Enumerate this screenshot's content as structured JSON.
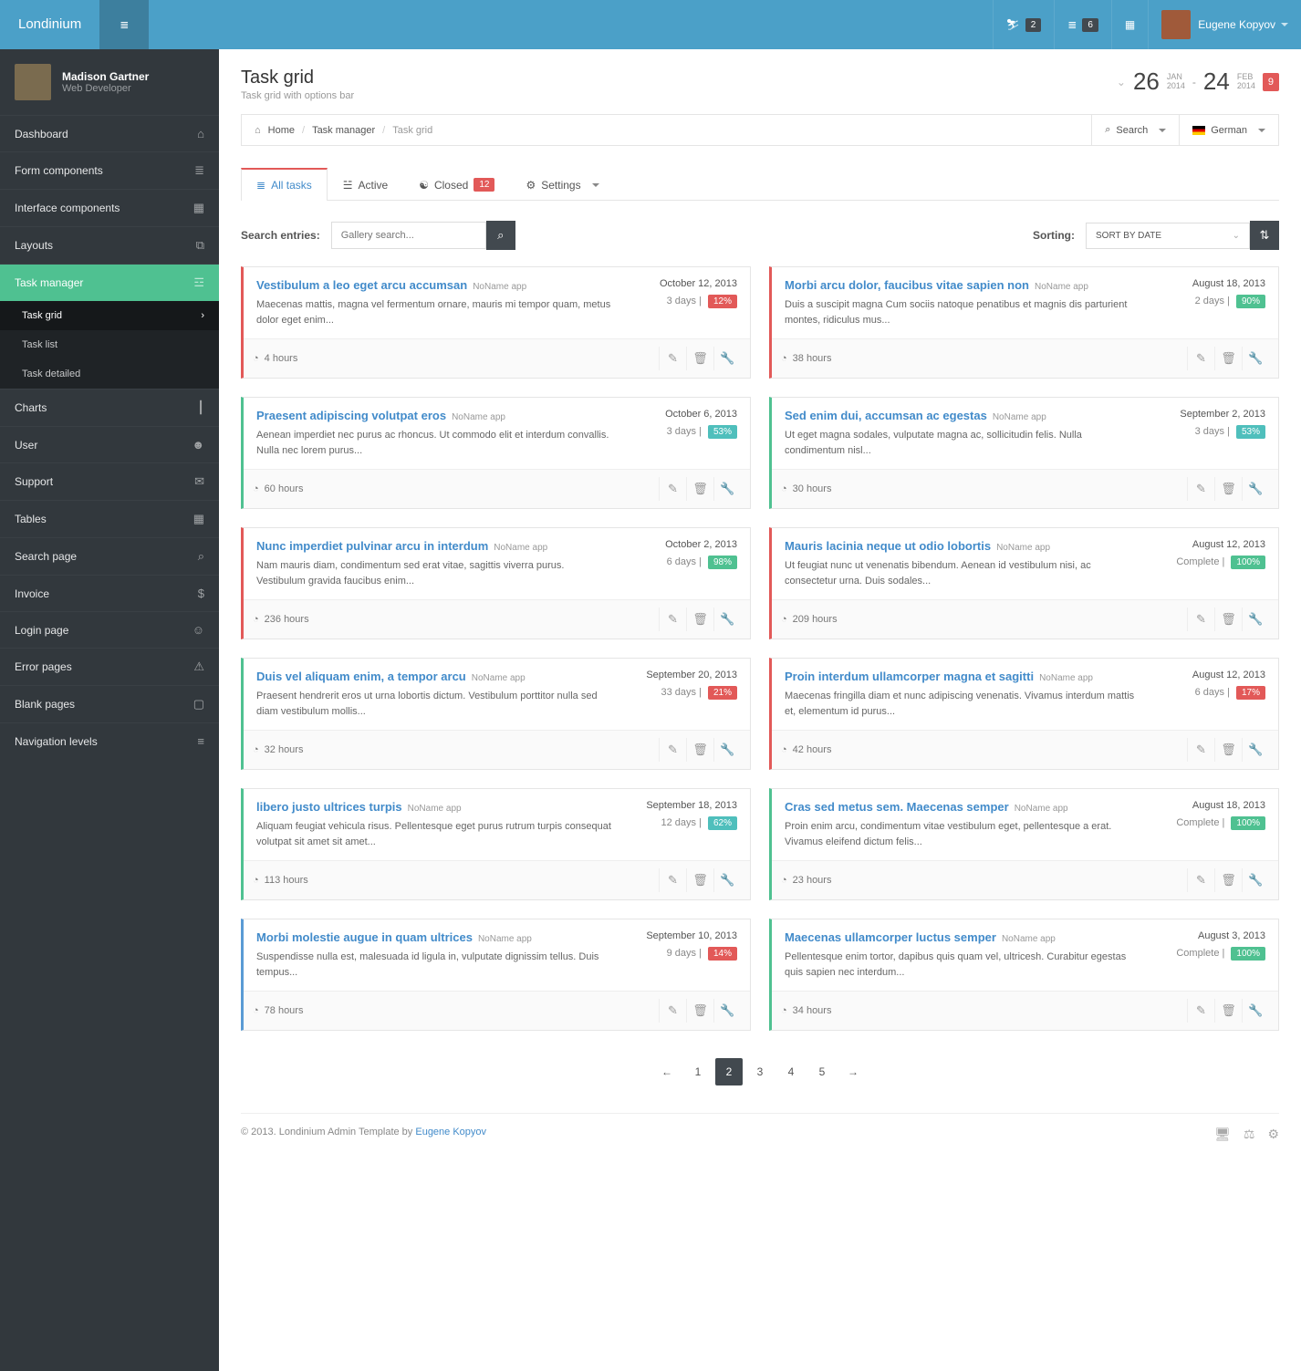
{
  "brand": "Londinium",
  "topnav": {
    "people_count": "2",
    "list_count": "6",
    "user_name": "Eugene Kopyov"
  },
  "sidebar": {
    "profile_name": "Madison Gartner",
    "profile_role": "Web Developer",
    "items": [
      {
        "label": "Dashboard",
        "icon": "⌂"
      },
      {
        "label": "Form components",
        "icon": "≣"
      },
      {
        "label": "Interface components",
        "icon": "▦"
      },
      {
        "label": "Layouts",
        "icon": "⧉"
      },
      {
        "label": "Task manager",
        "icon": "☲",
        "active": true
      },
      {
        "label": "Charts",
        "icon": "┃"
      },
      {
        "label": "User",
        "icon": "☻"
      },
      {
        "label": "Support",
        "icon": "✉"
      },
      {
        "label": "Tables",
        "icon": "▦"
      },
      {
        "label": "Search page",
        "icon": "⌕"
      },
      {
        "label": "Invoice",
        "icon": "$"
      },
      {
        "label": "Login page",
        "icon": "☺"
      },
      {
        "label": "Error pages",
        "icon": "⚠"
      },
      {
        "label": "Blank pages",
        "icon": "▢"
      },
      {
        "label": "Navigation levels",
        "icon": "≡"
      }
    ],
    "submenu": [
      {
        "label": "Task grid",
        "active": true
      },
      {
        "label": "Task list"
      },
      {
        "label": "Task detailed"
      }
    ]
  },
  "page": {
    "title": "Task grid",
    "subtitle": "Task grid with options bar",
    "date": {
      "d1": "26",
      "m1": "Jan",
      "y1": "2014",
      "d2": "24",
      "m2": "Feb",
      "y2": "2014",
      "tag": "9"
    }
  },
  "breadcrumb": {
    "home": "Home",
    "mid": "Task manager",
    "last": "Task grid",
    "search": "Search",
    "lang": "German"
  },
  "tabs": {
    "all": "All tasks",
    "active": "Active",
    "closed": "Closed",
    "closed_count": "12",
    "settings": "Settings"
  },
  "toolbar": {
    "search_label": "Search entries:",
    "search_placeholder": "Gallery search...",
    "sort_label": "Sorting:",
    "sort_value": "SORT BY DATE"
  },
  "tasks_left": [
    {
      "title": "Vestibulum a leo eget arcu accumsan",
      "app": "NoName app",
      "desc": "Maecenas mattis, magna vel fermentum ornare, mauris mi tempor quam, metus dolor eget enim...",
      "date": "October 12, 2013",
      "due": "3 days |",
      "pct": "12%",
      "pcls": "p-red",
      "hours": "4 hours",
      "border": "c-red"
    },
    {
      "title": "Praesent adipiscing volutpat eros",
      "app": "NoName app",
      "desc": "Aenean imperdiet nec purus ac rhoncus. Ut commodo elit et interdum convallis. Nulla nec lorem purus...",
      "date": "October 6, 2013",
      "due": "3 days |",
      "pct": "53%",
      "pcls": "p-teal",
      "hours": "60 hours",
      "border": "c-green"
    },
    {
      "title": "Nunc imperdiet pulvinar arcu in interdum",
      "app": "NoName app",
      "desc": "Nam mauris diam, condimentum sed erat vitae, sagittis viverra purus. Vestibulum gravida faucibus enim...",
      "date": "October 2, 2013",
      "due": "6 days |",
      "pct": "98%",
      "pcls": "p-green",
      "hours": "236 hours",
      "border": "c-red"
    },
    {
      "title": "Duis vel aliquam enim, a tempor arcu",
      "app": "NoName app",
      "desc": "Praesent hendrerit eros ut urna lobortis dictum. Vestibulum porttitor nulla sed diam vestibulum mollis...",
      "date": "September 20, 2013",
      "due": "33 days |",
      "pct": "21%",
      "pcls": "p-red",
      "hours": "32 hours",
      "border": "c-green"
    },
    {
      "title": "libero justo ultrices turpis",
      "app": "NoName app",
      "desc": "Aliquam feugiat vehicula risus. Pellentesque eget purus rutrum turpis consequat volutpat sit amet sit amet...",
      "date": "September 18, 2013",
      "due": "12 days |",
      "pct": "62%",
      "pcls": "p-teal",
      "hours": "113 hours",
      "border": "c-green"
    },
    {
      "title": "Morbi molestie augue in quam ultrices",
      "app": "NoName app",
      "desc": "Suspendisse nulla est, malesuada id ligula in, vulputate dignissim tellus. Duis tempus...",
      "date": "September 10, 2013",
      "due": "9 days |",
      "pct": "14%",
      "pcls": "p-red",
      "hours": "78 hours",
      "border": "c-blue"
    }
  ],
  "tasks_right": [
    {
      "title": "Morbi arcu dolor, faucibus vitae sapien non",
      "app": "NoName app",
      "desc": "Duis a suscipit magna Cum sociis natoque penatibus et magnis dis parturient montes, ridiculus mus...",
      "date": "August 18, 2013",
      "due": "2 days |",
      "pct": "90%",
      "pcls": "p-green",
      "hours": "38 hours",
      "border": "c-red"
    },
    {
      "title": "Sed enim dui, accumsan ac egestas",
      "app": "NoName app",
      "desc": "Ut eget magna sodales, vulputate magna ac, sollicitudin felis. Nulla condimentum nisl...",
      "date": "September 2, 2013",
      "due": "3 days |",
      "pct": "53%",
      "pcls": "p-teal",
      "hours": "30 hours",
      "border": "c-green"
    },
    {
      "title": "Mauris lacinia neque ut odio lobortis",
      "app": "NoName app",
      "desc": "Ut feugiat nunc ut venenatis bibendum. Aenean id vestibulum nisi, ac consectetur urna. Duis sodales...",
      "date": "August 12, 2013",
      "due": "Complete |",
      "pct": "100%",
      "pcls": "p-green",
      "hours": "209 hours",
      "border": "c-red"
    },
    {
      "title": "Proin interdum ullamcorper magna et sagitti",
      "app": "NoName app",
      "desc": "Maecenas fringilla diam et nunc adipiscing venenatis. Vivamus interdum mattis et, elementum id purus...",
      "date": "August 12, 2013",
      "due": "6 days |",
      "pct": "17%",
      "pcls": "p-red",
      "hours": "42 hours",
      "border": "c-red"
    },
    {
      "title": "Cras sed metus sem. Maecenas semper",
      "app": "NoName app",
      "desc": "Proin enim arcu, condimentum vitae vestibulum eget, pellentesque a erat. Vivamus eleifend dictum felis...",
      "date": "August 18, 2013",
      "due": "Complete |",
      "pct": "100%",
      "pcls": "p-green",
      "hours": "23 hours",
      "border": "c-green"
    },
    {
      "title": "Maecenas ullamcorper luctus semper",
      "app": "NoName app",
      "desc": "Pellentesque enim tortor, dapibus quis quam vel, ultricesh. Curabitur egestas quis sapien nec interdum...",
      "date": "August 3, 2013",
      "due": "Complete |",
      "pct": "100%",
      "pcls": "p-green",
      "hours": "34 hours",
      "border": "c-green"
    }
  ],
  "pagination": [
    "1",
    "2",
    "3",
    "4",
    "5"
  ],
  "pagination_active": "2",
  "footer": {
    "text": "© 2013. Londinium Admin Template by ",
    "author": "Eugene Kopyov"
  }
}
